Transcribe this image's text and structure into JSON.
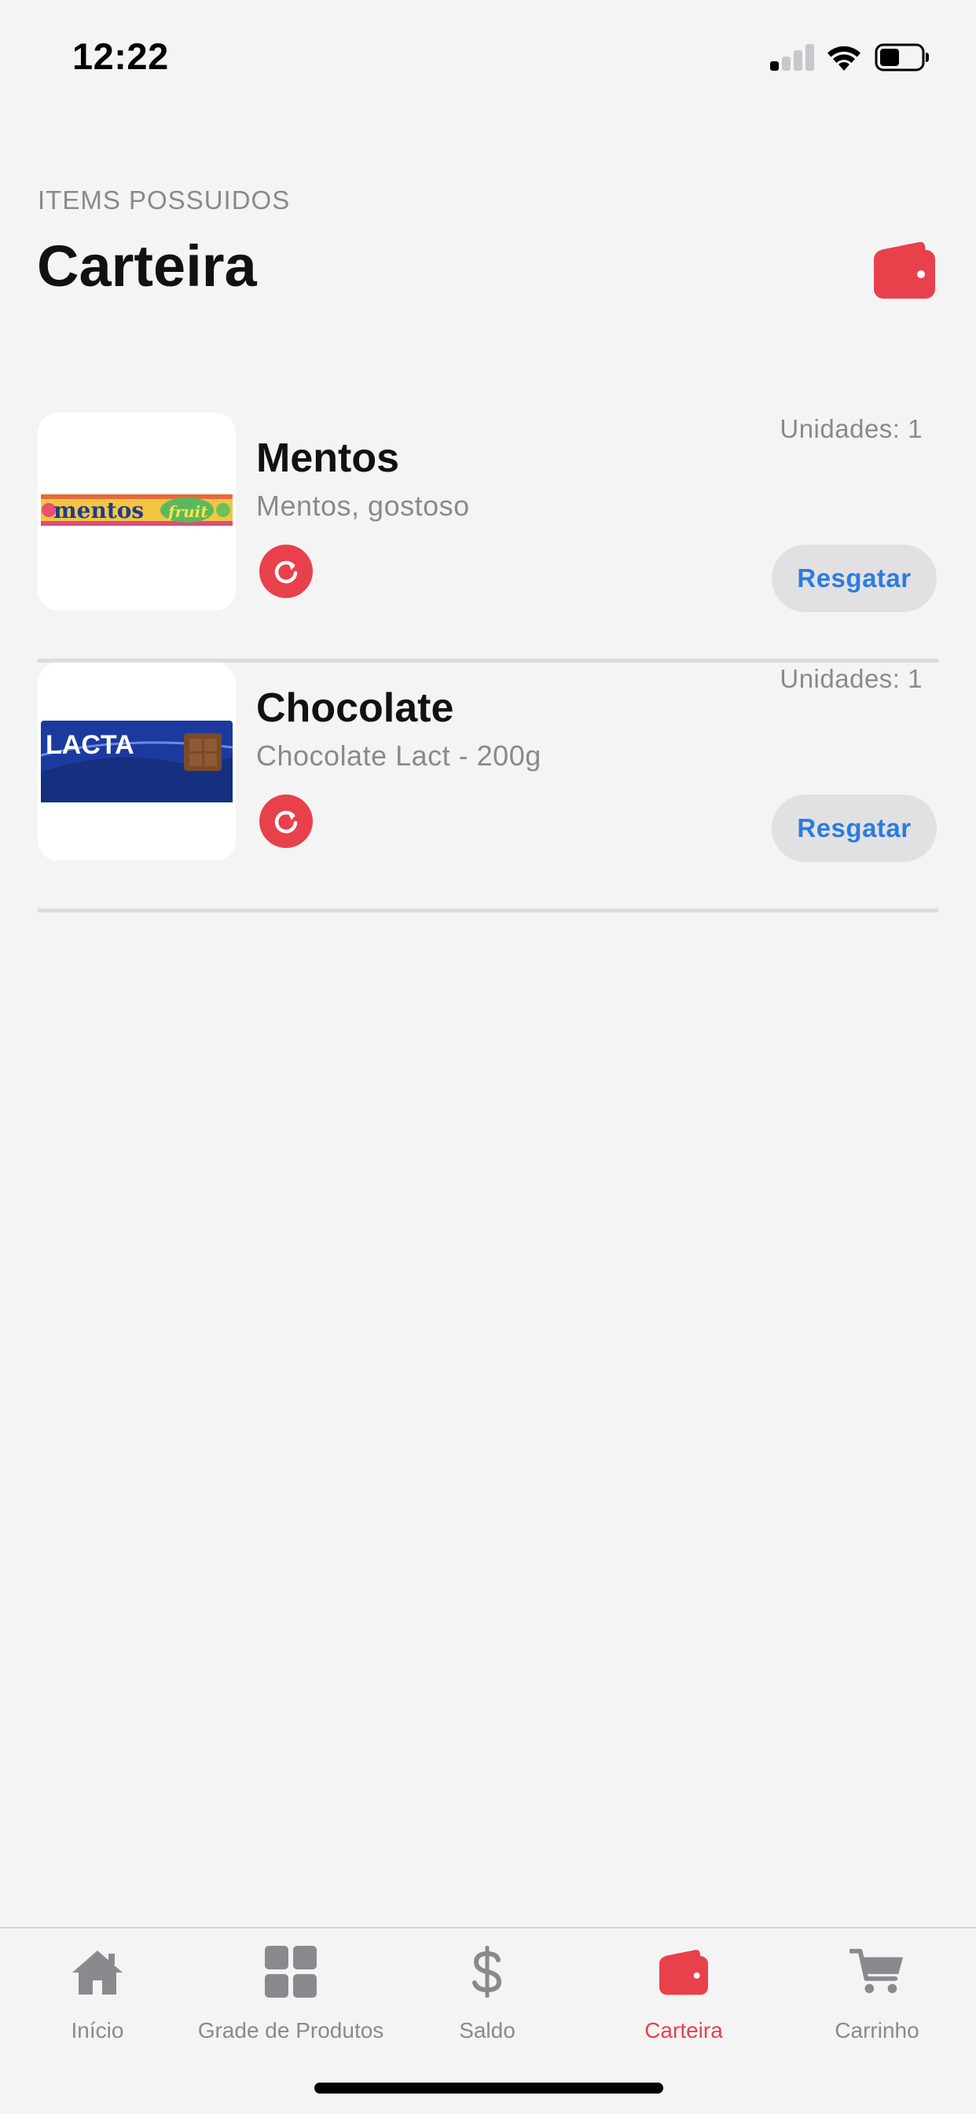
{
  "status_bar": {
    "time": "12:22"
  },
  "header": {
    "caption": "ITEMS POSSUIDOS",
    "title": "Carteira",
    "icon": "wallet-icon"
  },
  "items": [
    {
      "name": "Mentos",
      "description": "Mentos, gostoso",
      "units": "Unidades: 1",
      "redeem_label": "Resgatar",
      "image_brand": "mentos",
      "image_subbrand": "fruit"
    },
    {
      "name": "Chocolate",
      "description": "Chocolate Lact - 200g",
      "units": "Unidades: 1",
      "redeem_label": "Resgatar",
      "image_brand": "LACTA"
    }
  ],
  "tab_bar": {
    "tabs": [
      {
        "label": "Início",
        "icon": "home-icon"
      },
      {
        "label": "Grade de Produtos",
        "icon": "grid-icon"
      },
      {
        "label": "Saldo",
        "icon": "dollar-icon"
      },
      {
        "label": "Carteira",
        "icon": "wallet-icon",
        "active": true
      },
      {
        "label": "Carrinho",
        "icon": "cart-icon"
      }
    ]
  },
  "colors": {
    "accent": "#e8414c",
    "link": "#2c7be0",
    "background": "#f4f4f5",
    "muted_text": "#8a8a8e"
  }
}
